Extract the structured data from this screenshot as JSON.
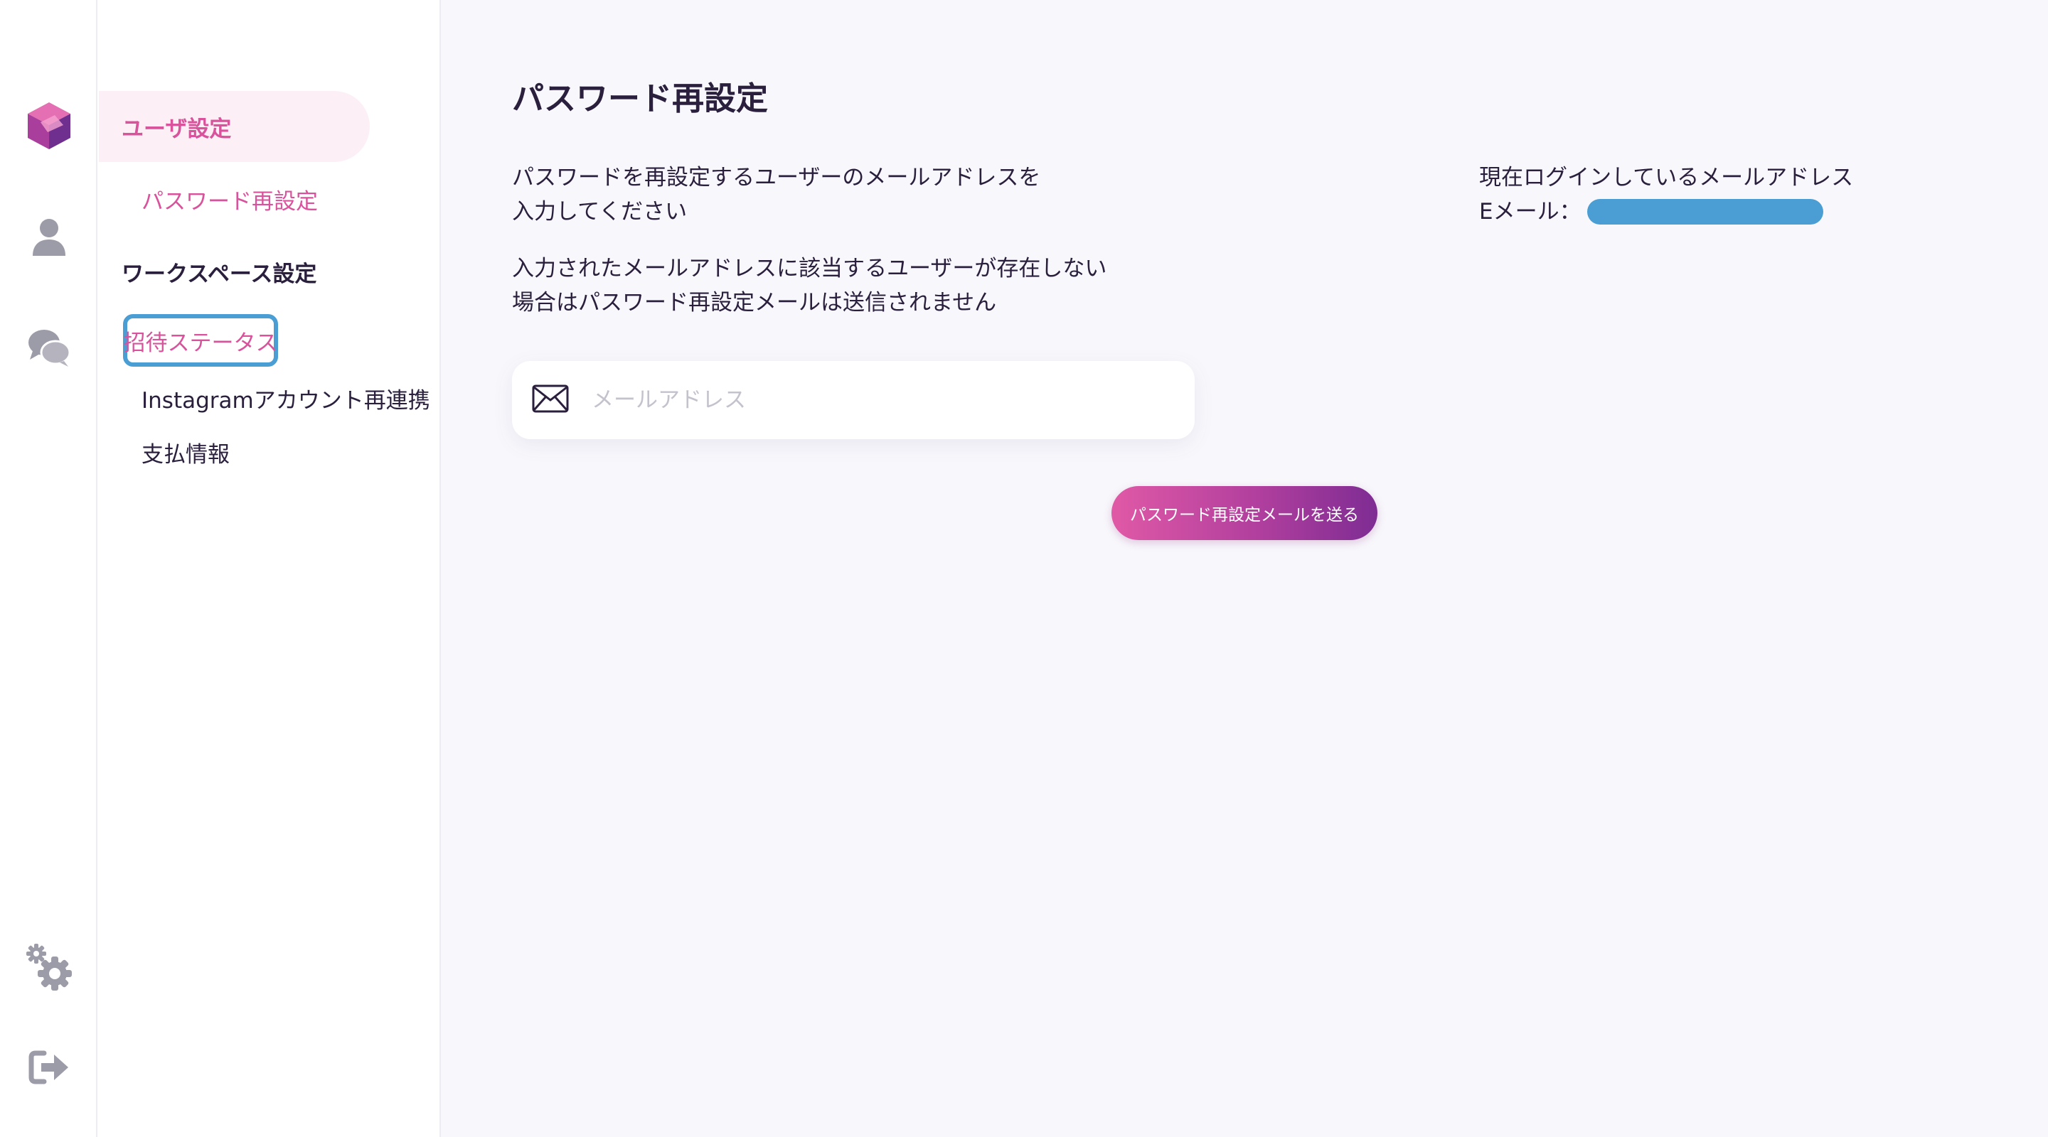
{
  "rail": {
    "icons": [
      "logo-cube-icon",
      "user-icon",
      "chat-bubbles-icon",
      "settings-gears-icon",
      "logout-icon"
    ]
  },
  "subnav": {
    "user_settings_label": "ユーザ設定",
    "password_reset_label": "パスワード再設定",
    "workspace_settings_heading": "ワークスペース設定",
    "invitation_status_label": "招待ステータス",
    "instagram_relink_label": "Instagramアカウント再連携",
    "payment_info_label": "支払情報"
  },
  "main": {
    "title": "パスワード再設定",
    "description_lines": [
      "パスワードを再設定するユーザーのメールアドレスを",
      "入力してください"
    ],
    "notice_lines": [
      "入力されたメールアドレスに該当するユーザーが存在しない",
      "場合はパスワード再設定メールは送信されません"
    ],
    "email_input": {
      "value": "",
      "placeholder": "メールアドレス",
      "icon": "envelope-icon"
    },
    "send_button_label": "パスワード再設定メールを送る",
    "current_login_label": "現在ログインしているメールアドレス",
    "email_prefix_label": "Eメール：",
    "email_value_redacted": true
  },
  "colors": {
    "accent_pink": "#d8539c",
    "focus_ring": "#4a9ed4",
    "text": "#2a1f3d",
    "rail_icon": "#9c9ba8"
  }
}
